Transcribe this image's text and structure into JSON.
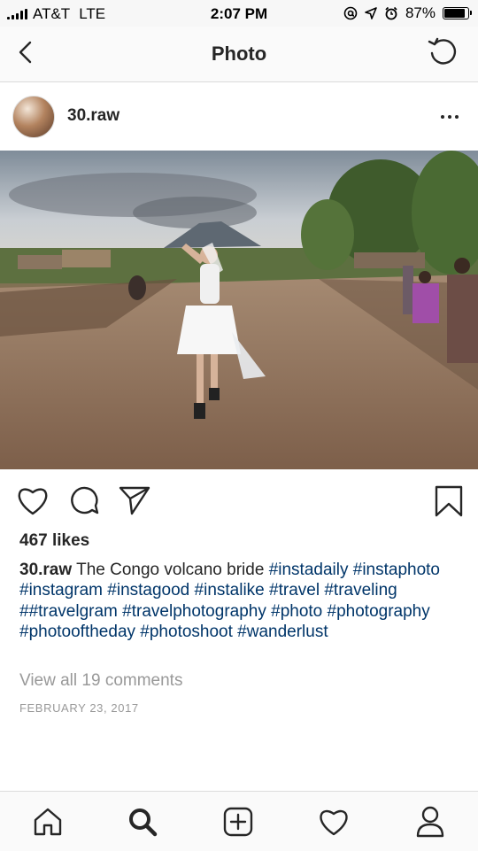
{
  "status_bar": {
    "carrier": "AT&T",
    "network": "LTE",
    "time": "2:07 PM",
    "battery_percent": "87%",
    "battery_level": 0.87,
    "icons": [
      "signal-icon",
      "at-sign-icon",
      "location-arrow-icon",
      "alarm-icon",
      "battery-icon"
    ]
  },
  "nav": {
    "title": "Photo",
    "back_icon": "chevron-left-icon",
    "refresh_icon": "refresh-icon"
  },
  "post": {
    "username": "30.raw",
    "more_icon": "more-dots-icon",
    "likes": "467 likes",
    "caption_text": "The Congo volcano bride",
    "hashtags_line1": "#instadaily",
    "hashtags": [
      "#instaphoto",
      "#instagram",
      "#instagood",
      "#instalike",
      "#travel",
      "#traveling",
      "##travelgram",
      "#travelphotography",
      "#photo",
      "#photography",
      "#photooftheday",
      "#photoshoot",
      "#wanderlust"
    ],
    "comments_link": "View all 19 comments",
    "date": "FEBRUARY 23, 2017"
  },
  "actions": {
    "icons": [
      "heart-icon",
      "comment-icon",
      "share-icon",
      "bookmark-icon"
    ]
  },
  "tab_bar": {
    "icons": [
      "home-icon",
      "search-icon",
      "add-post-icon",
      "activity-heart-icon",
      "profile-icon"
    ]
  },
  "colors": {
    "hashtag": "#003569",
    "muted": "#999999",
    "text": "#262626",
    "bar_bg": "#fafafa",
    "divider": "#dbdbdb"
  }
}
